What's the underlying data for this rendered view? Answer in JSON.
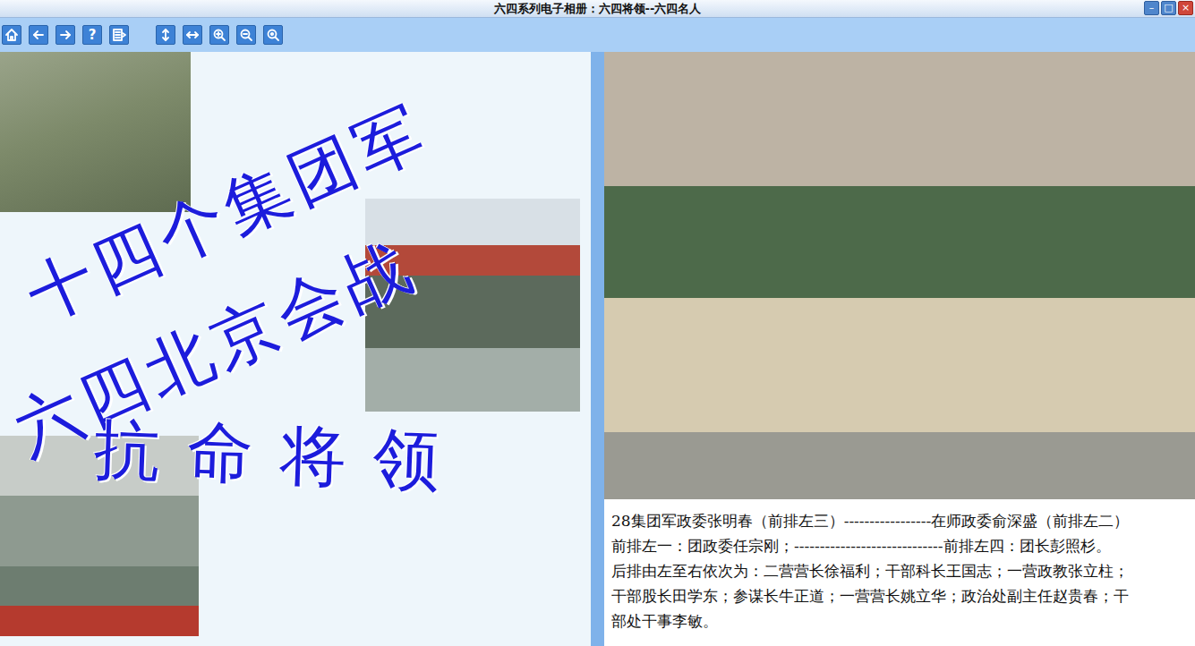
{
  "window": {
    "title": "六四系列电子相册：六四将领--六四名人",
    "controls": [
      "–",
      "□",
      "×"
    ]
  },
  "toolbar": [
    {
      "kind": "home"
    },
    {
      "kind": "back"
    },
    {
      "kind": "forward"
    },
    {
      "kind": "help",
      "label": "?"
    },
    {
      "kind": "list"
    },
    {
      "kind": "fit-height"
    },
    {
      "kind": "fit-width"
    },
    {
      "kind": "zoom-in"
    },
    {
      "kind": "zoom-out"
    },
    {
      "kind": "zoom-reset"
    }
  ],
  "collage": {
    "headlines": [
      "十四个集团军",
      "六四北京会战",
      "抗命将领"
    ]
  },
  "album": {
    "caption_lines": [
      "28集团军政委张明春（前排左三）-----------------在师政委俞深盛（前排左二）",
      "前排左一：团政委任宗刚；-----------------------------前排左四：团长彭照杉。",
      "后排由左至右依次为：二营营长徐福利；干部科长王国志；一营政教张立柱；",
      "干部股长田学东；参谋长牛正道；一营营长姚立华；政治处副主任赵贵春；干",
      "部处干事李敏。"
    ]
  }
}
